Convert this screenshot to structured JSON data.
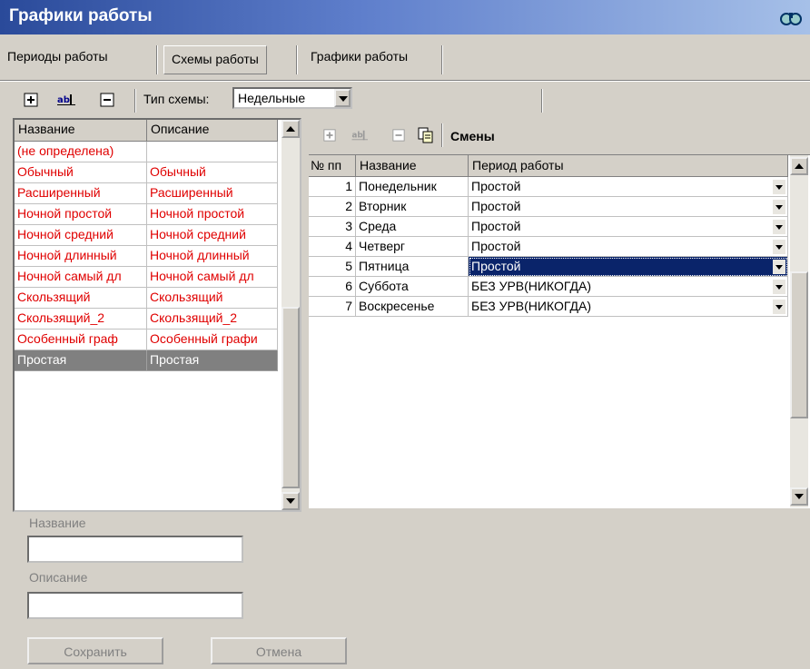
{
  "window": {
    "title": "Графики работы"
  },
  "tabs": [
    {
      "label": "Периоды работы"
    },
    {
      "label": "Схемы работы"
    },
    {
      "label": "Графики работы"
    }
  ],
  "toolbar": {
    "buttons": [
      "add-icon",
      "rename-icon",
      "delete-icon"
    ],
    "scheme_type_label": "Тип схемы:",
    "scheme_type_value": "Недельные"
  },
  "schemes": {
    "columns": [
      "Название",
      "Описание"
    ],
    "rows": [
      {
        "name": "(не определена)",
        "desc": ""
      },
      {
        "name": "Обычный",
        "desc": "Обычный"
      },
      {
        "name": "Расширенный",
        "desc": "Расширенный"
      },
      {
        "name": "Ночной простой",
        "desc": "Ночной простой"
      },
      {
        "name": "Ночной средний",
        "desc": "Ночной средний"
      },
      {
        "name": "Ночной длинный",
        "desc": "Ночной длинный"
      },
      {
        "name": "Ночной самый дл",
        "desc": "Ночной самый дл"
      },
      {
        "name": "Скользящий",
        "desc": "Скользящий"
      },
      {
        "name": "Скользящий_2",
        "desc": "Скользящий_2"
      },
      {
        "name": "Особенный граф",
        "desc": "Особенный графи"
      },
      {
        "name": "Простая",
        "desc": "Простая"
      }
    ],
    "selected_index": 10
  },
  "shifts": {
    "title": "Смены",
    "columns": [
      "№ пп",
      "Название",
      "Период работы"
    ],
    "rows": [
      {
        "n": "1",
        "name": "Понедельник",
        "period": "Простой"
      },
      {
        "n": "2",
        "name": "Вторник",
        "period": "Простой"
      },
      {
        "n": "3",
        "name": "Среда",
        "period": "Простой"
      },
      {
        "n": "4",
        "name": "Четверг",
        "period": "Простой"
      },
      {
        "n": "5",
        "name": "Пятница",
        "period": "Простой"
      },
      {
        "n": "6",
        "name": "Суббота",
        "period": "БЕЗ УРВ(НИКОГДА)"
      },
      {
        "n": "7",
        "name": "Воскресенье",
        "period": "БЕЗ УРВ(НИКОГДА)"
      }
    ],
    "selected_index": 4
  },
  "form": {
    "name_label": "Название",
    "name_value": "",
    "desc_label": "Описание",
    "desc_value": "",
    "save_label": "Сохранить",
    "cancel_label": "Отмена"
  },
  "colors": {
    "title_bar": "#2a4a9a",
    "inactive_row_text": "#e00000",
    "selection": "#0a246a"
  }
}
